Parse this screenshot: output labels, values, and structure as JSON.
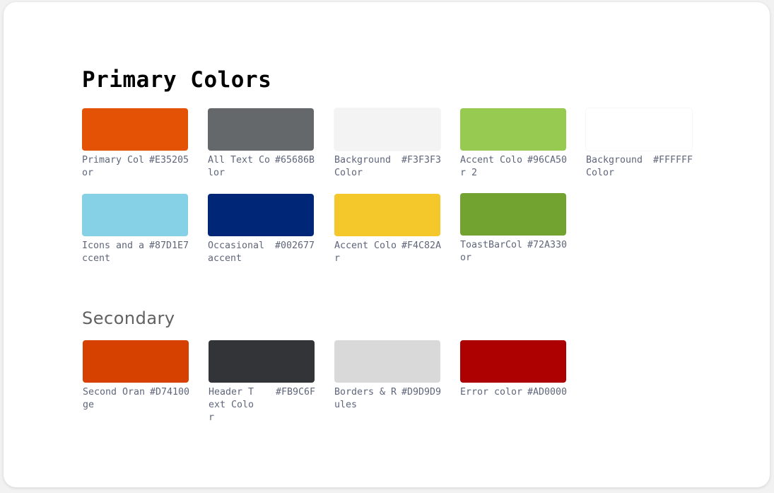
{
  "primary": {
    "heading": "Primary Colors",
    "swatches": [
      {
        "name": "Primary Color",
        "hex": "#E35205",
        "color": "#E35205"
      },
      {
        "name": "All Text Color",
        "hex": "#65686B",
        "color": "#65686B"
      },
      {
        "name": "Background Color",
        "hex": "#F3F3F3",
        "color": "#F3F3F3"
      },
      {
        "name": "Accent Color 2",
        "hex": "#96CA50",
        "color": "#96CA50"
      },
      {
        "name": "Background Color",
        "hex": "#FFFFFF",
        "color": "#FFFFFF"
      },
      {
        "name": "Icons and accent",
        "hex": "#87D1E7",
        "color": "#87D1E7"
      },
      {
        "name": "Occasional accent",
        "hex": "#002677",
        "color": "#002677"
      },
      {
        "name": "Accent Color",
        "hex": "#F4C82A",
        "color": "#F4C82A"
      },
      {
        "name": "ToastBarColor",
        "hex": "#72A330",
        "color": "#72A330"
      }
    ]
  },
  "secondary": {
    "heading": "Secondary",
    "swatches": [
      {
        "name": "Second Orange",
        "hex": "#D74100",
        "color": "#D74100"
      },
      {
        "name": "Header Text Color",
        "hex": "#FB9C6F",
        "color": "#333437"
      },
      {
        "name": "Borders & Rules",
        "hex": "#D9D9D9",
        "color": "#D9D9D9"
      },
      {
        "name": "Error color",
        "hex": "#AD0000",
        "color": "#AD0000"
      }
    ]
  }
}
